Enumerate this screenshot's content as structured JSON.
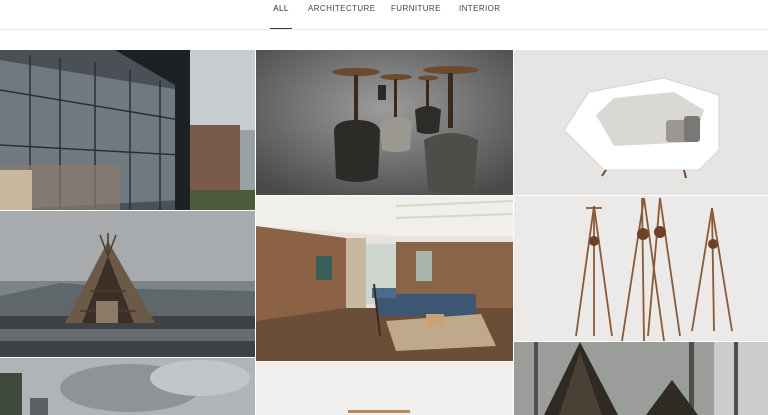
{
  "filters": {
    "all": "ALL",
    "architecture": "ARCHITECTURE",
    "furniture": "FURNITURE",
    "interior": "INTERIOR",
    "active": "all"
  },
  "gallery": {
    "items": [
      {
        "subject": "glass-facade-house"
      },
      {
        "subject": "stools"
      },
      {
        "subject": "lounge-chair"
      },
      {
        "subject": "wooden-tipi-structure"
      },
      {
        "subject": "interior-living-room"
      },
      {
        "subject": "wooden-coat-stands"
      },
      {
        "subject": "cloudy-architecture"
      },
      {
        "subject": "furniture-bench"
      },
      {
        "subject": "tipi-forest"
      }
    ]
  }
}
